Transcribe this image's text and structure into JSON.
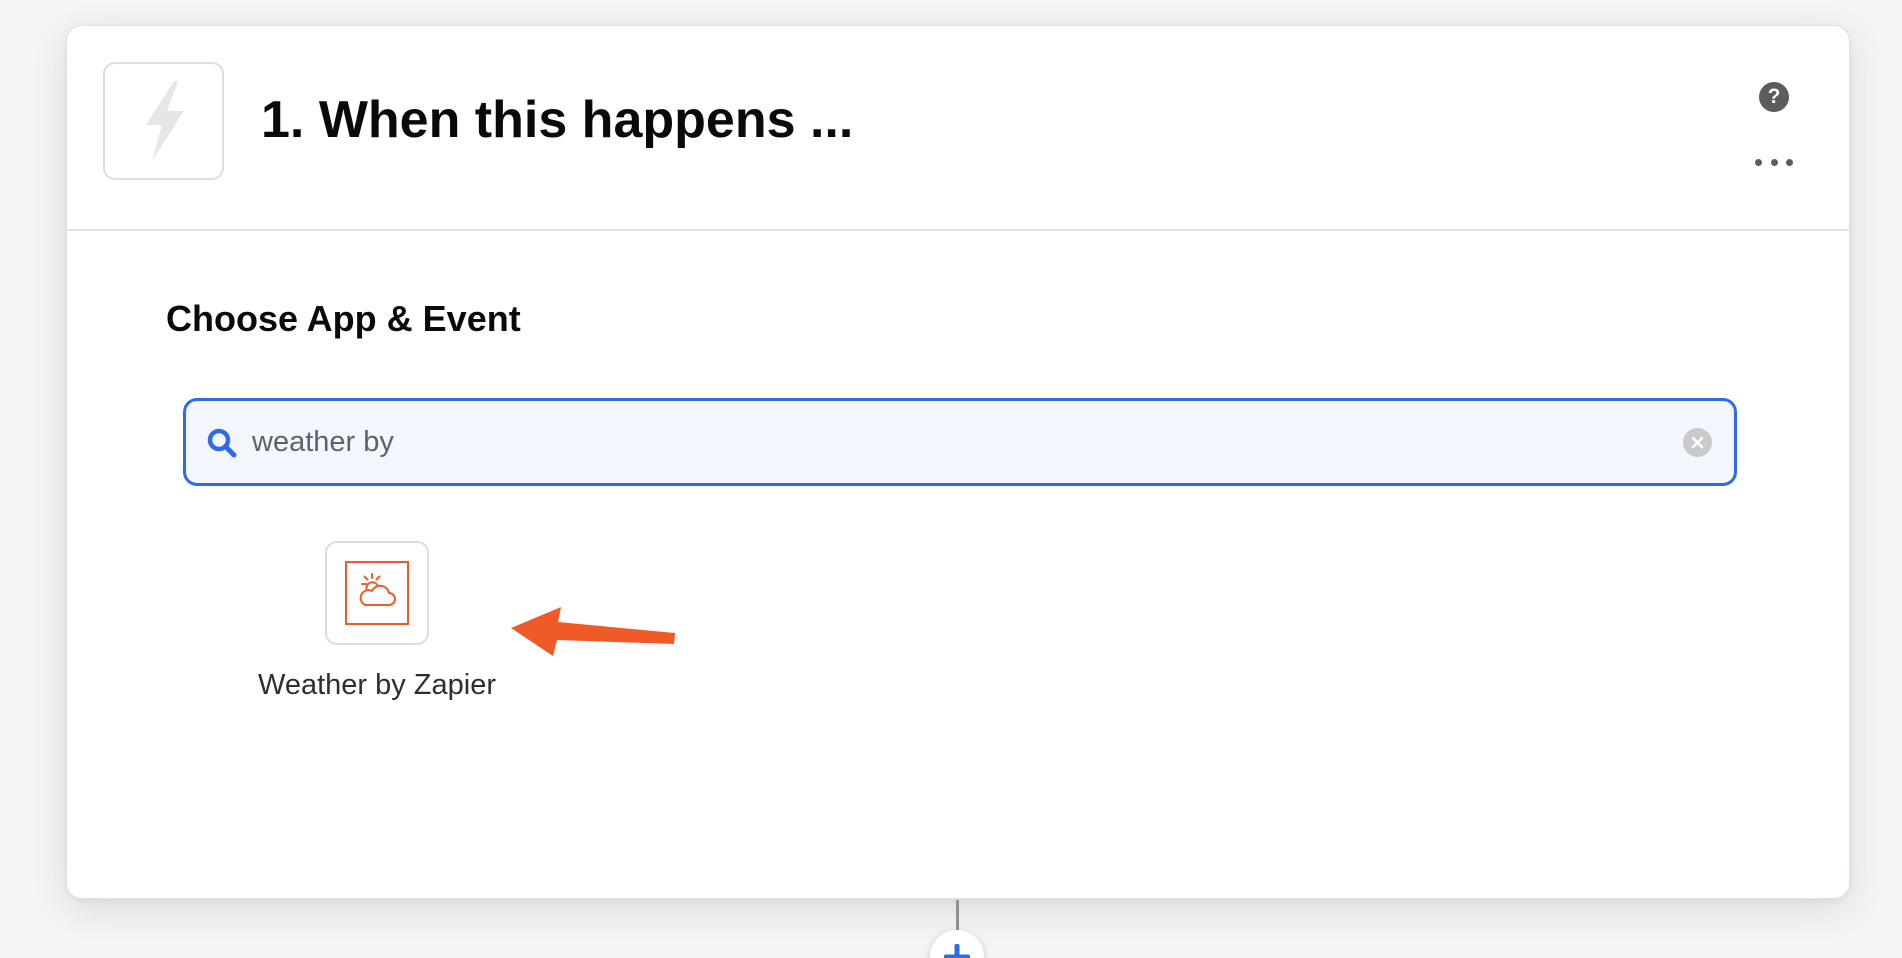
{
  "step": {
    "title": "1. When this happens ..."
  },
  "section": {
    "title": "Choose App & Event"
  },
  "search": {
    "value": "weather by"
  },
  "results": [
    {
      "label": "Weather by Zapier",
      "icon": "weather-sun-cloud-icon"
    }
  ],
  "colors": {
    "accent": "#2f6be6",
    "app_brand": "#f05a28",
    "arrow": "#ef5a28"
  }
}
